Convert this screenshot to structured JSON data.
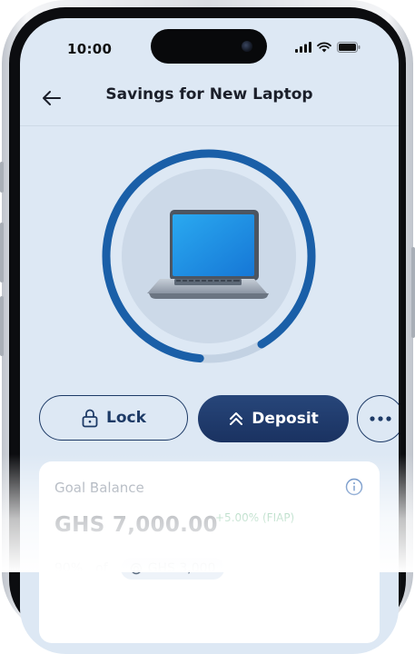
{
  "status_bar": {
    "time": "10:00"
  },
  "header": {
    "title": "Savings for New Laptop",
    "back_icon": "arrow-left-icon"
  },
  "goal": {
    "icon": "laptop-icon",
    "progress_percent": 90,
    "ring_color": "#1a5fa8"
  },
  "actions": {
    "lock_label": "Lock",
    "deposit_label": "Deposit",
    "more_icon": "more-horizontal-icon"
  },
  "card": {
    "label": "Goal Balance",
    "balance": "GHS 7,000.00",
    "change": "+5.00% (FIAP)",
    "progress_text": "90%",
    "of_text": "of",
    "target": "GHS 3,000"
  },
  "colors": {
    "accent": "#1a3261",
    "screen_bg": "#dde8f4",
    "positive": "#2f9a5b"
  }
}
